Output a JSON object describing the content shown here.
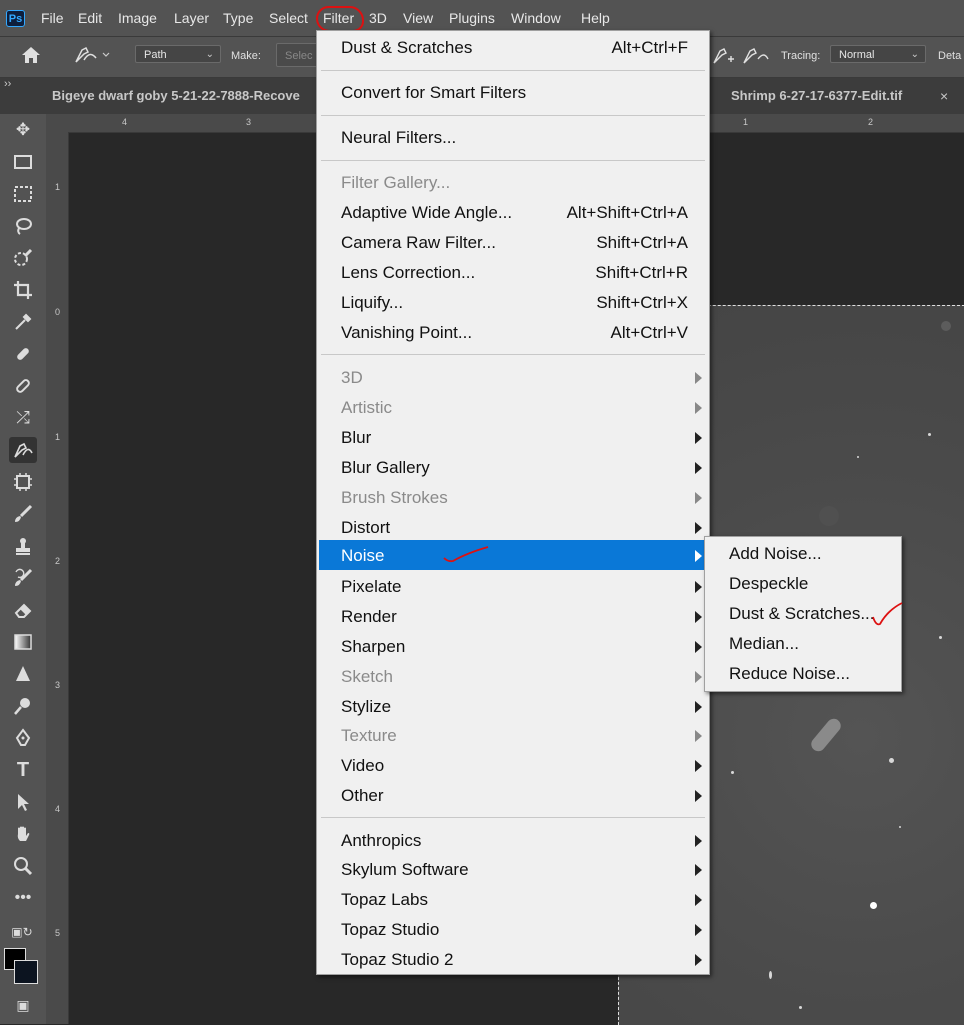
{
  "menubar": {
    "logo": "Ps",
    "items": [
      "File",
      "Edit",
      "Image",
      "Layer",
      "Type",
      "Select",
      "Filter",
      "3D",
      "View",
      "Plugins",
      "Window",
      "Help"
    ]
  },
  "options": {
    "mode_value": "Path",
    "make_label": "Make:",
    "select_placeholder": "Selec",
    "tracing_label": "Tracing:",
    "tracing_value": "Normal",
    "detail_label": "Deta"
  },
  "tabs": [
    {
      "label": "Bigeye dwarf goby 5-21-22-7888-Recove"
    },
    {
      "label": "Shrimp  6-27-17-6377-Edit.tif"
    }
  ],
  "tab_close": "×",
  "panel_toggle": "››",
  "ruler": {
    "top": [
      "4",
      "3",
      "1",
      "2"
    ],
    "left": [
      "1",
      "0",
      "1",
      "2",
      "3",
      "4",
      "5"
    ]
  },
  "filter_menu": {
    "items": [
      {
        "label": "Dust & Scratches",
        "shortcut": "Alt+Ctrl+F"
      },
      {
        "label": "Convert for Smart Filters"
      },
      {
        "label": "Neural Filters..."
      },
      {
        "label": "Filter Gallery...",
        "disabled": true
      },
      {
        "label": "Adaptive Wide Angle...",
        "shortcut": "Alt+Shift+Ctrl+A"
      },
      {
        "label": "Camera Raw Filter...",
        "shortcut": "Shift+Ctrl+A"
      },
      {
        "label": "Lens Correction...",
        "shortcut": "Shift+Ctrl+R"
      },
      {
        "label": "Liquify...",
        "shortcut": "Shift+Ctrl+X"
      },
      {
        "label": "Vanishing Point...",
        "shortcut": "Alt+Ctrl+V"
      },
      {
        "label": "3D",
        "disabled": true,
        "submenu": true
      },
      {
        "label": "Artistic",
        "disabled": true,
        "submenu": true
      },
      {
        "label": "Blur",
        "submenu": true
      },
      {
        "label": "Blur Gallery",
        "submenu": true
      },
      {
        "label": "Brush Strokes",
        "disabled": true,
        "submenu": true
      },
      {
        "label": "Distort",
        "submenu": true
      },
      {
        "label": "Noise",
        "submenu": true,
        "highlighted": true
      },
      {
        "label": "Pixelate",
        "submenu": true
      },
      {
        "label": "Render",
        "submenu": true
      },
      {
        "label": "Sharpen",
        "submenu": true
      },
      {
        "label": "Sketch",
        "disabled": true,
        "submenu": true
      },
      {
        "label": "Stylize",
        "submenu": true
      },
      {
        "label": "Texture",
        "disabled": true,
        "submenu": true
      },
      {
        "label": "Video",
        "submenu": true
      },
      {
        "label": "Other",
        "submenu": true
      },
      {
        "label": "Anthropics",
        "submenu": true
      },
      {
        "label": "Skylum Software",
        "submenu": true
      },
      {
        "label": "Topaz Labs",
        "submenu": true
      },
      {
        "label": "Topaz Studio",
        "submenu": true
      },
      {
        "label": "Topaz Studio 2",
        "submenu": true
      }
    ]
  },
  "noise_submenu": {
    "items": [
      "Add Noise...",
      "Despeckle",
      "Dust & Scratches...",
      "Median...",
      "Reduce Noise..."
    ]
  },
  "colors": {
    "highlight": "#0a78d7",
    "annotation": "#dd1111",
    "menu_bg": "#f0f0f0",
    "app_bg": "#535353"
  }
}
